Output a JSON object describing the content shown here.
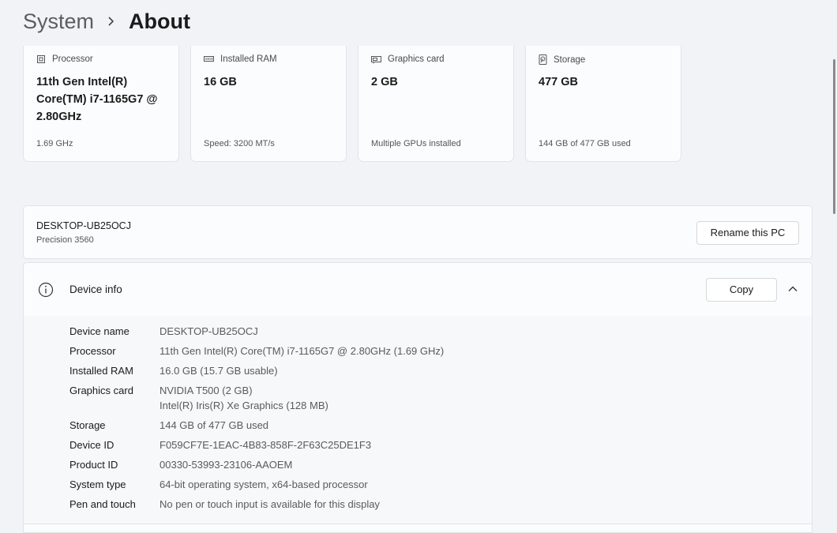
{
  "breadcrumb": {
    "parent": "System",
    "current": "About"
  },
  "cards": [
    {
      "icon": "processor-icon",
      "title": "Processor",
      "value": "11th Gen Intel(R) Core(TM) i7-1165G7 @ 2.80GHz",
      "sub": "1.69 GHz"
    },
    {
      "icon": "ram-icon",
      "title": "Installed RAM",
      "value": "16 GB",
      "sub": "Speed: 3200 MT/s"
    },
    {
      "icon": "graphics-card-icon",
      "title": "Graphics card",
      "value": "2 GB",
      "sub": "Multiple GPUs installed"
    },
    {
      "icon": "storage-icon",
      "title": "Storage",
      "value": "477 GB",
      "sub": "144 GB of 477 GB used"
    }
  ],
  "pc": {
    "name": "DESKTOP-UB25OCJ",
    "model": "Precision 3560",
    "rename_label": "Rename this PC"
  },
  "device_info": {
    "title": "Device info",
    "copy_label": "Copy",
    "rows": [
      {
        "label": "Device name",
        "value": "DESKTOP-UB25OCJ",
        "value2": ""
      },
      {
        "label": "Processor",
        "value": "11th Gen Intel(R) Core(TM) i7-1165G7 @ 2.80GHz (1.69 GHz)",
        "value2": ""
      },
      {
        "label": "Installed RAM",
        "value": "16.0 GB (15.7 GB usable)",
        "value2": ""
      },
      {
        "label": "Graphics card",
        "value": "NVIDIA T500 (2 GB)",
        "value2": "Intel(R) Iris(R) Xe Graphics (128 MB)"
      },
      {
        "label": "Storage",
        "value": "144 GB of 477 GB used",
        "value2": ""
      },
      {
        "label": "Device ID",
        "value": "F059CF7E-1EAC-4B83-858F-2F63C25DE1F3",
        "value2": ""
      },
      {
        "label": "Product ID",
        "value": "00330-53993-23106-AAOEM",
        "value2": ""
      },
      {
        "label": "System type",
        "value": "64-bit operating system, x64-based processor",
        "value2": ""
      },
      {
        "label": "Pen and touch",
        "value": "No pen or touch input is available for this display",
        "value2": ""
      }
    ]
  }
}
